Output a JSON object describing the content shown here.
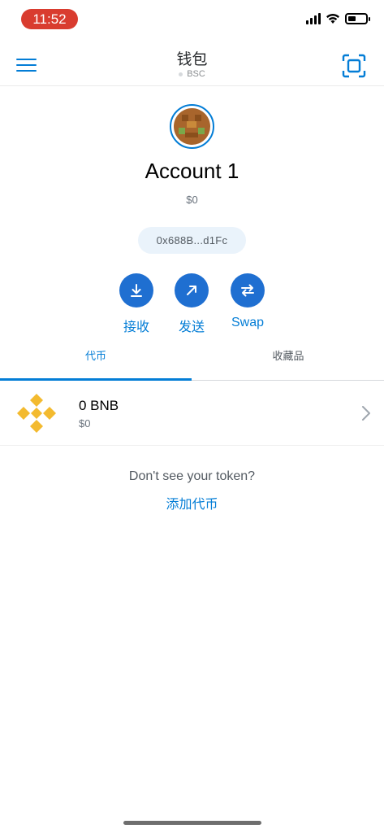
{
  "status_bar": {
    "time": "11:52",
    "battery_level": 0.45
  },
  "header": {
    "title": "钱包",
    "network": "BSC"
  },
  "account": {
    "name": "Account 1",
    "balance": "$0",
    "address": "0x688B...d1Fc"
  },
  "actions": [
    {
      "label": "接收",
      "icon": "arrow-down-icon"
    },
    {
      "label": "发送",
      "icon": "arrow-up-right-icon"
    },
    {
      "label": "Swap",
      "icon": "swap-icon"
    }
  ],
  "tabs": [
    {
      "label": "代币",
      "active": true
    },
    {
      "label": "收藏品",
      "active": false
    }
  ],
  "tokens": [
    {
      "amount": "0 BNB",
      "fiat": "$0",
      "icon": "bnb-logo-icon"
    }
  ],
  "footer": {
    "prompt": "Don't see your token?",
    "add_token_label": "添加代币"
  },
  "colors": {
    "accent": "#037dd6",
    "action_button": "#1f6fd1",
    "bnb": "#f3ba2f",
    "time_pill": "#d93c2f"
  }
}
